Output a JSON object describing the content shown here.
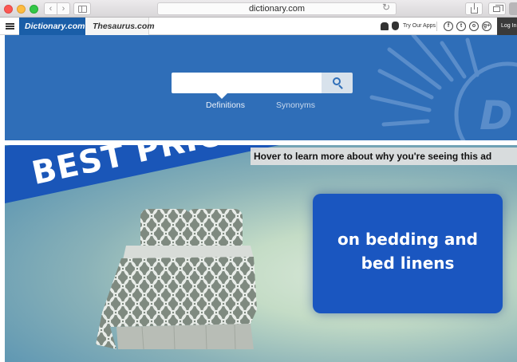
{
  "browser": {
    "address": "dictionary.com"
  },
  "site": {
    "tabs": [
      "Dictionary.com",
      "Thesaurus.com"
    ],
    "try_apps": "Try Our Apps",
    "social_icons": [
      "facebook-icon",
      "twitter-icon",
      "instagram-icon",
      "google-plus-icon"
    ],
    "social_glyphs": [
      "f",
      "t",
      "o",
      "g+"
    ],
    "login": "Log In"
  },
  "hero": {
    "search_value": "",
    "search_tabs": [
      "Definitions",
      "Synonyms"
    ],
    "active_tab": "Definitions",
    "logo_letter": "D"
  },
  "ad": {
    "headline": "BEST PRICE",
    "hover_text": "Hover to learn more about why you're seeing this ad",
    "box_line1": "on bedding and",
    "box_line2": "bed linens"
  },
  "colors": {
    "brand_blue": "#1a5ea8",
    "hero_blue": "#2f6eb8",
    "ad_blue": "#1a56c0"
  }
}
